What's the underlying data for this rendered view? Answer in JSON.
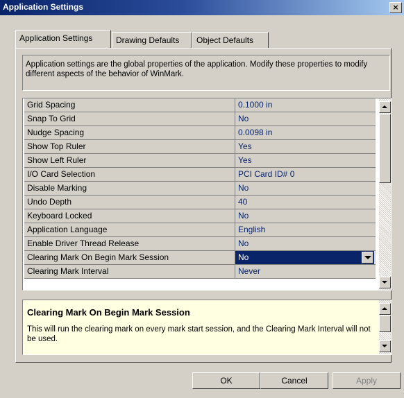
{
  "window": {
    "title": "Application Settings",
    "close_glyph": "×"
  },
  "tabs": [
    {
      "label": "Application Settings",
      "active": true
    },
    {
      "label": "Drawing Defaults",
      "active": false
    },
    {
      "label": "Object Defaults",
      "active": false
    }
  ],
  "description": "Application settings are the global properties of the application. Modify these properties to modify different aspects of the behavior of WinMark.",
  "properties": [
    {
      "name": "Grid Spacing",
      "value": "0.1000 in"
    },
    {
      "name": "Snap To Grid",
      "value": "No"
    },
    {
      "name": "Nudge Spacing",
      "value": "0.0098 in"
    },
    {
      "name": "Show Top Ruler",
      "value": "Yes"
    },
    {
      "name": "Show Left Ruler",
      "value": "Yes"
    },
    {
      "name": "I/O Card Selection",
      "value": "PCI Card ID# 0"
    },
    {
      "name": "Disable Marking",
      "value": "No"
    },
    {
      "name": "Undo Depth",
      "value": "40"
    },
    {
      "name": "Keyboard Locked",
      "value": "No"
    },
    {
      "name": "Application Language",
      "value": "English"
    },
    {
      "name": "Enable Driver Thread Release",
      "value": "No"
    },
    {
      "name": "Clearing Mark On Begin Mark Session",
      "value": "No",
      "selected": true
    },
    {
      "name": "Clearing Mark Interval",
      "value": "Never"
    }
  ],
  "help": {
    "title": "Clearing Mark On Begin Mark Session",
    "text": "This will run the clearing mark on every mark start session, and the Clearing Mark Interval will not be used."
  },
  "buttons": {
    "ok": "OK",
    "cancel": "Cancel",
    "apply": "Apply"
  },
  "colors": {
    "value_text": "#0a246a",
    "selection": "#0a246a",
    "help_background": "#ffffe1"
  }
}
